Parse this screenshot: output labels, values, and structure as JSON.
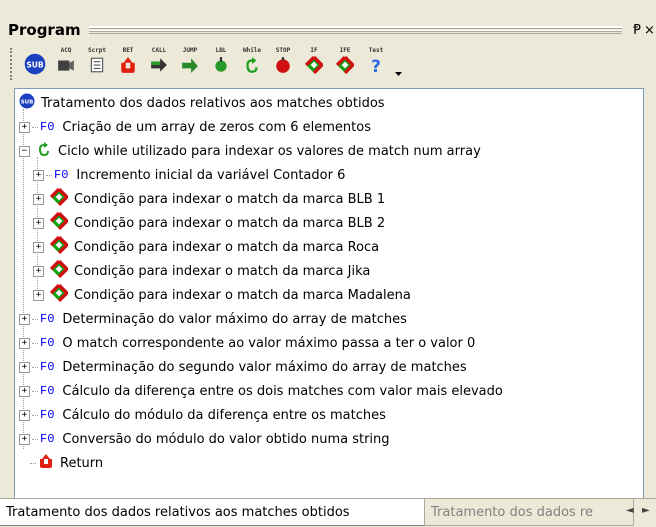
{
  "panel": {
    "title": "Program",
    "pin_glyph": "Ᵽ",
    "close_glyph": "×"
  },
  "toolbar": {
    "items": [
      {
        "label": "",
        "icon": "sub-icon",
        "name": "sub-button"
      },
      {
        "label": "ACQ",
        "icon": "camera-icon",
        "name": "acq-button"
      },
      {
        "label": "Scrpt",
        "icon": "script-icon",
        "name": "script-button"
      },
      {
        "label": "RET",
        "icon": "return-icon",
        "name": "ret-button"
      },
      {
        "label": "CALL",
        "icon": "call-icon",
        "name": "call-button"
      },
      {
        "label": "JUMP",
        "icon": "jump-icon",
        "name": "jump-button"
      },
      {
        "label": "LBL",
        "icon": "label-icon",
        "name": "lbl-button"
      },
      {
        "label": "While",
        "icon": "while-icon",
        "name": "while-button"
      },
      {
        "label": "STOP",
        "icon": "stop-icon",
        "name": "stop-button"
      },
      {
        "label": "IF",
        "icon": "if-icon",
        "name": "if-button"
      },
      {
        "label": "IFE",
        "icon": "ife-icon",
        "name": "ife-button"
      },
      {
        "label": "Test",
        "icon": "test-icon",
        "name": "test-button"
      }
    ]
  },
  "tree": {
    "root_label": "Tratamento dos dados relativos aos matches obtidos",
    "f0_tag": "F0",
    "nodes": [
      {
        "label": "Criação de um array de zeros com 6 elementos"
      },
      {
        "label": "Ciclo while utilizado para indexar os valores de match num array"
      },
      {
        "label": "Incremento inicial da variável Contador 6"
      },
      {
        "label": "Condição para indexar o match da marca BLB 1"
      },
      {
        "label": "Condição para indexar o match da marca BLB 2"
      },
      {
        "label": "Condição para indexar o match da marca Roca"
      },
      {
        "label": "Condição para indexar o match da marca Jika"
      },
      {
        "label": "Condição para indexar o match da marca Madalena"
      },
      {
        "label": "Determinação do valor máximo do array de matches"
      },
      {
        "label": "O match correspondente ao valor máximo passa a ter o valor 0"
      },
      {
        "label": "Determinação do segundo valor máximo do array de matches"
      },
      {
        "label": "Cálculo da diferença entre os dois matches com valor mais elevado"
      },
      {
        "label": "Cálculo do módulo da diferença entre os matches"
      },
      {
        "label": "Conversão do módulo do valor obtido numa string"
      },
      {
        "label": "Return"
      }
    ]
  },
  "tabs": {
    "active": "Tratamento dos dados relativos aos matches obtidos",
    "inactive": "Tratamento dos dados re",
    "prev_glyph": "◄",
    "next_glyph": "►"
  },
  "colors": {
    "f0": "#0000ff",
    "diamond_red": "#d01010",
    "diamond_green": "#10a010",
    "return_red": "#e02010",
    "while_green": "#20a020",
    "sub_blue": "#1a3fbf"
  }
}
